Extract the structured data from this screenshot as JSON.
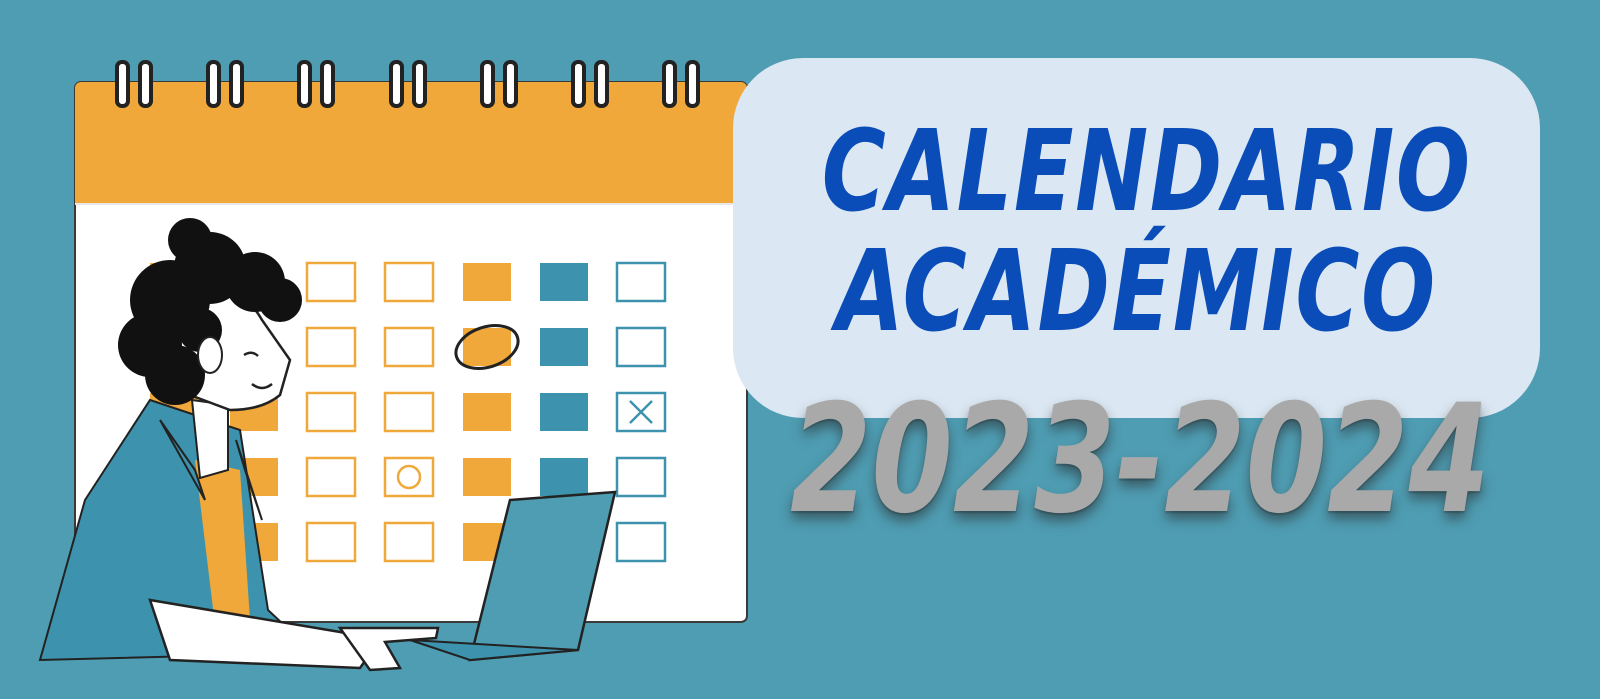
{
  "banner": {
    "title_line_1": "CALENDARIO",
    "title_line_2": "ACADÉMICO",
    "year_range": "2023-2024"
  },
  "colors": {
    "background": "#4f9db3",
    "calendar_header": "#f0a83a",
    "calendar_body": "#ffffff",
    "title_card": "#dbe7f2",
    "title_text": "#0b4db8",
    "year_text": "#a9a9a9",
    "accent_teal": "#3d93ad"
  }
}
